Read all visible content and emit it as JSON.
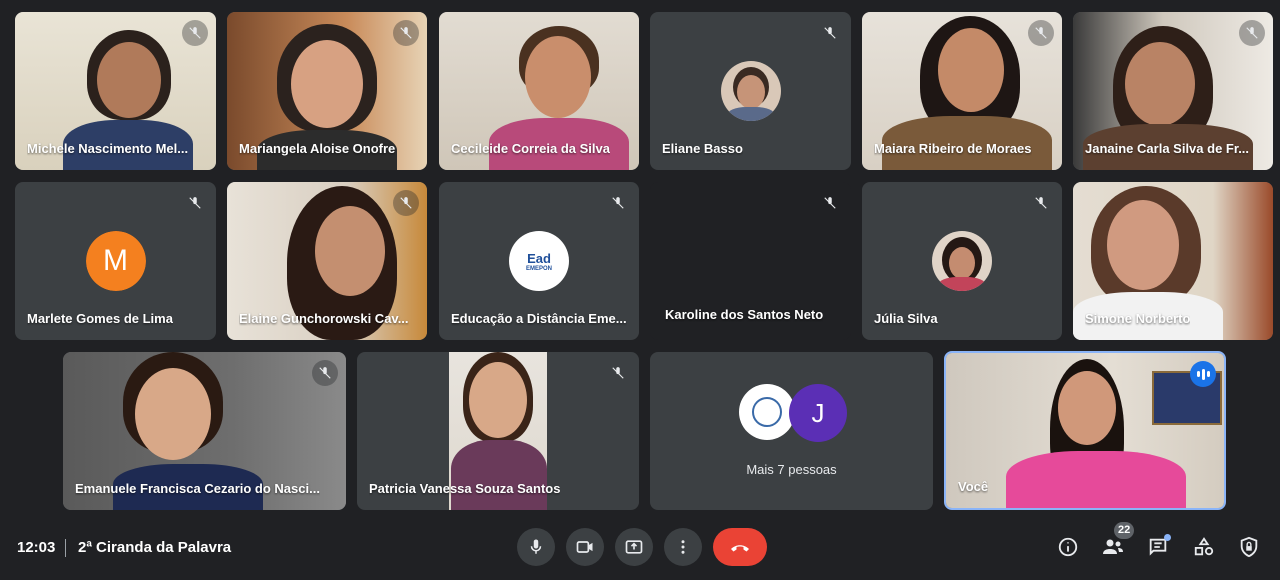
{
  "participants": [
    {
      "name": "Michele Nascimento Mel...",
      "muted": true
    },
    {
      "name": "Mariangela Aloise Onofre",
      "muted": true
    },
    {
      "name": "Cecileide Correia da Silva",
      "muted": false
    },
    {
      "name": "Eliane Basso",
      "muted": true
    },
    {
      "name": "Maiara Ribeiro de Moraes",
      "muted": true
    },
    {
      "name": "Janaine Carla Silva de Fr...",
      "muted": true
    },
    {
      "name": "Marlete Gomes de Lima",
      "muted": true,
      "initial": "M",
      "avatar_color": "#f4801f"
    },
    {
      "name": "Elaine Gunchorowski Cav...",
      "muted": true
    },
    {
      "name": "Educação a Distância Eme...",
      "muted": true,
      "logo_text": "Ead",
      "logo_sub": "EMEPON"
    },
    {
      "name": "Karoline dos Santos Neto",
      "muted": true
    },
    {
      "name": "Júlia Silva",
      "muted": true
    },
    {
      "name": "Simone Norberto",
      "muted": false
    },
    {
      "name": "Emanuele Francisca Cezario do Nasci...",
      "muted": true
    },
    {
      "name": "Patricia Vanessa Souza Santos",
      "muted": true
    },
    {
      "name": "Você",
      "speaking": true
    }
  ],
  "more_people": {
    "label": "Mais 7 pessoas",
    "initial": "J",
    "avatar_color": "#5b2fb5"
  },
  "bottom_bar": {
    "time": "12:03",
    "meeting_title": "2ª Ciranda da Palavra",
    "participant_count": "22"
  },
  "colors": {
    "background": "#202124",
    "tile": "#3c4043",
    "hangup": "#ea4335",
    "active_border": "#8ab4f8"
  }
}
